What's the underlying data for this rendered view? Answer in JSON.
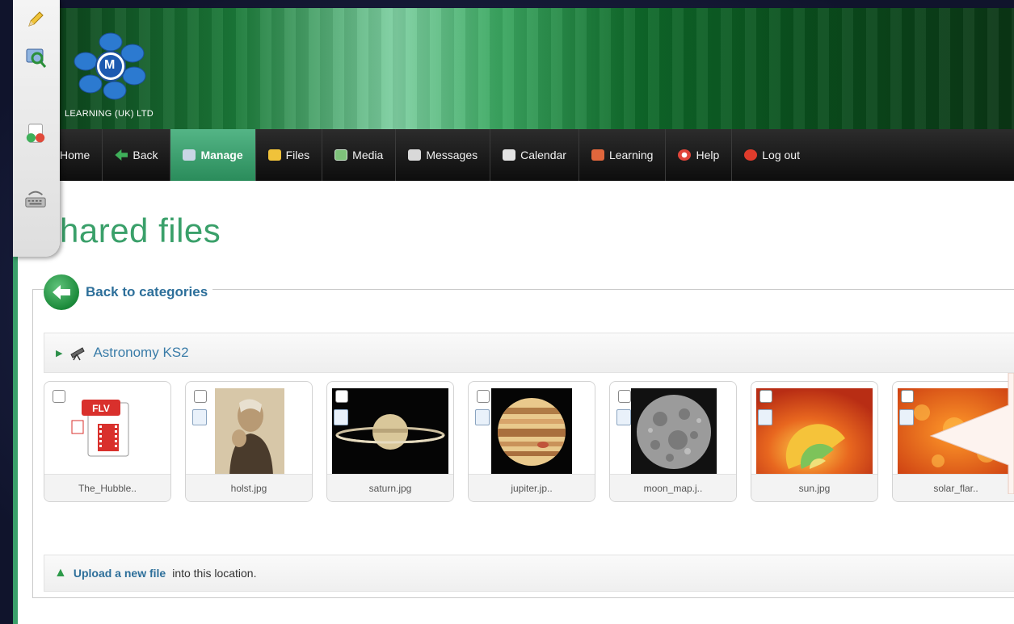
{
  "branding": {
    "logo_letter": "M",
    "company": "LEARNING (UK) LTD"
  },
  "nav": {
    "items": [
      {
        "label": "Home",
        "icon": "home-icon"
      },
      {
        "label": "Back",
        "icon": "back-arrow-icon"
      },
      {
        "label": "Manage",
        "icon": "manage-icon"
      },
      {
        "label": "Files",
        "icon": "files-icon"
      },
      {
        "label": "Media",
        "icon": "media-icon"
      },
      {
        "label": "Messages",
        "icon": "messages-icon"
      },
      {
        "label": "Calendar",
        "icon": "calendar-icon"
      },
      {
        "label": "Learning",
        "icon": "learning-icon"
      },
      {
        "label": "Help",
        "icon": "help-icon"
      },
      {
        "label": "Log out",
        "icon": "logout-icon"
      }
    ],
    "active": "Manage"
  },
  "page": {
    "title": "hared files",
    "back_link": "Back to categories",
    "category": "Astronomy KS2"
  },
  "files": [
    {
      "name": "The_Hubble..",
      "type": "flv"
    },
    {
      "name": "holst.jpg",
      "type": "image"
    },
    {
      "name": "saturn.jpg",
      "type": "image"
    },
    {
      "name": "jupiter.jp..",
      "type": "image"
    },
    {
      "name": "moon_map.j..",
      "type": "image"
    },
    {
      "name": "sun.jpg",
      "type": "image"
    },
    {
      "name": "solar_flar..",
      "type": "image"
    }
  ],
  "upload": {
    "link": "Upload a new file",
    "rest": "into this location."
  },
  "colors": {
    "accent_green": "#3aa06a",
    "link_blue": "#2d6f9a",
    "nav_dark": "#111111"
  }
}
